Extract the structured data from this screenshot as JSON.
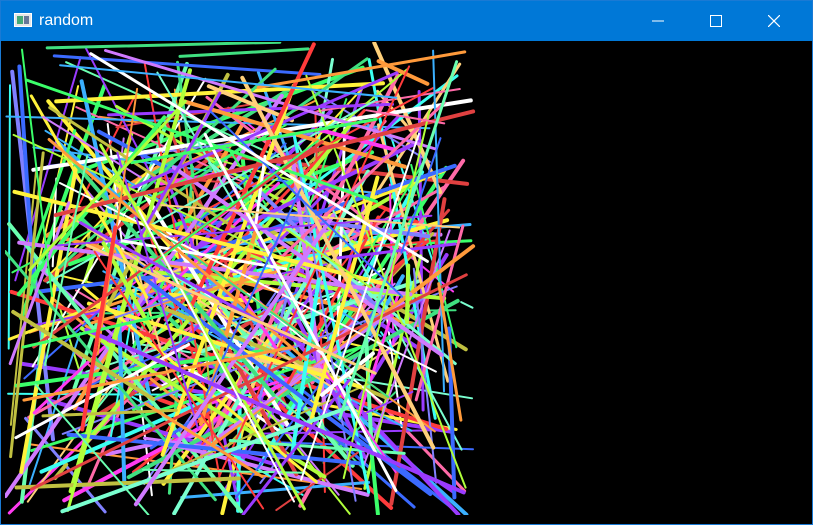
{
  "window": {
    "title": "random",
    "controls": {
      "minimize_icon": "minimize-icon",
      "maximize_icon": "maximize-icon",
      "close_icon": "close-icon"
    },
    "colors": {
      "titlebar": "#0078d7",
      "client_background": "#000000"
    }
  },
  "canvas": {
    "description_icon": "random-lines-drawing",
    "line_colors": [
      "#ff3b3b",
      "#3bff6a",
      "#3b6aff",
      "#ff3bf0",
      "#fff23b",
      "#3bfff2",
      "#ff9a3b",
      "#9a3bff",
      "#ffffff",
      "#6affb0",
      "#ff6aa8",
      "#b0ff3b",
      "#3bb0ff",
      "#d07aff",
      "#ffd07a",
      "#7affd0",
      "#e04040",
      "#40e080",
      "#8080ff",
      "#c0c040"
    ]
  }
}
